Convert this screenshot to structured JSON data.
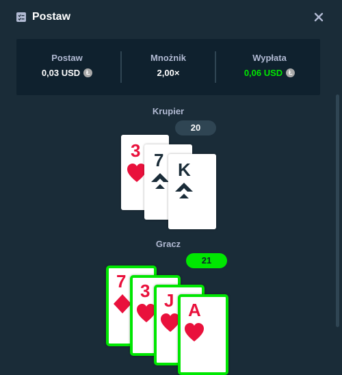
{
  "header": {
    "title": "Postaw",
    "close_icon": "close-icon",
    "bet_icon": "bet-slip-icon"
  },
  "summary": {
    "bet_label": "Postaw",
    "bet_value": "0,03 USD",
    "multiplier_label": "Mnożnik",
    "multiplier_value": "2,00×",
    "payout_label": "Wypłata",
    "payout_value": "0,06 USD",
    "currency_icon": "litecoin-icon",
    "payout_color": "#00e701"
  },
  "dealer": {
    "label": "Krupier",
    "score": "20",
    "cards": [
      {
        "rank": "3",
        "suit": "hearts",
        "color": "red"
      },
      {
        "rank": "7",
        "suit": "spades",
        "color": "dark"
      },
      {
        "rank": "K",
        "suit": "spades",
        "color": "dark"
      }
    ]
  },
  "player": {
    "label": "Gracz",
    "score": "21",
    "score_color": "#00e701",
    "cards": [
      {
        "rank": "7",
        "suit": "diamonds",
        "color": "red"
      },
      {
        "rank": "3",
        "suit": "hearts",
        "color": "red"
      },
      {
        "rank": "J",
        "suit": "hearts",
        "color": "red"
      },
      {
        "rank": "A",
        "suit": "hearts",
        "color": "red"
      }
    ]
  }
}
